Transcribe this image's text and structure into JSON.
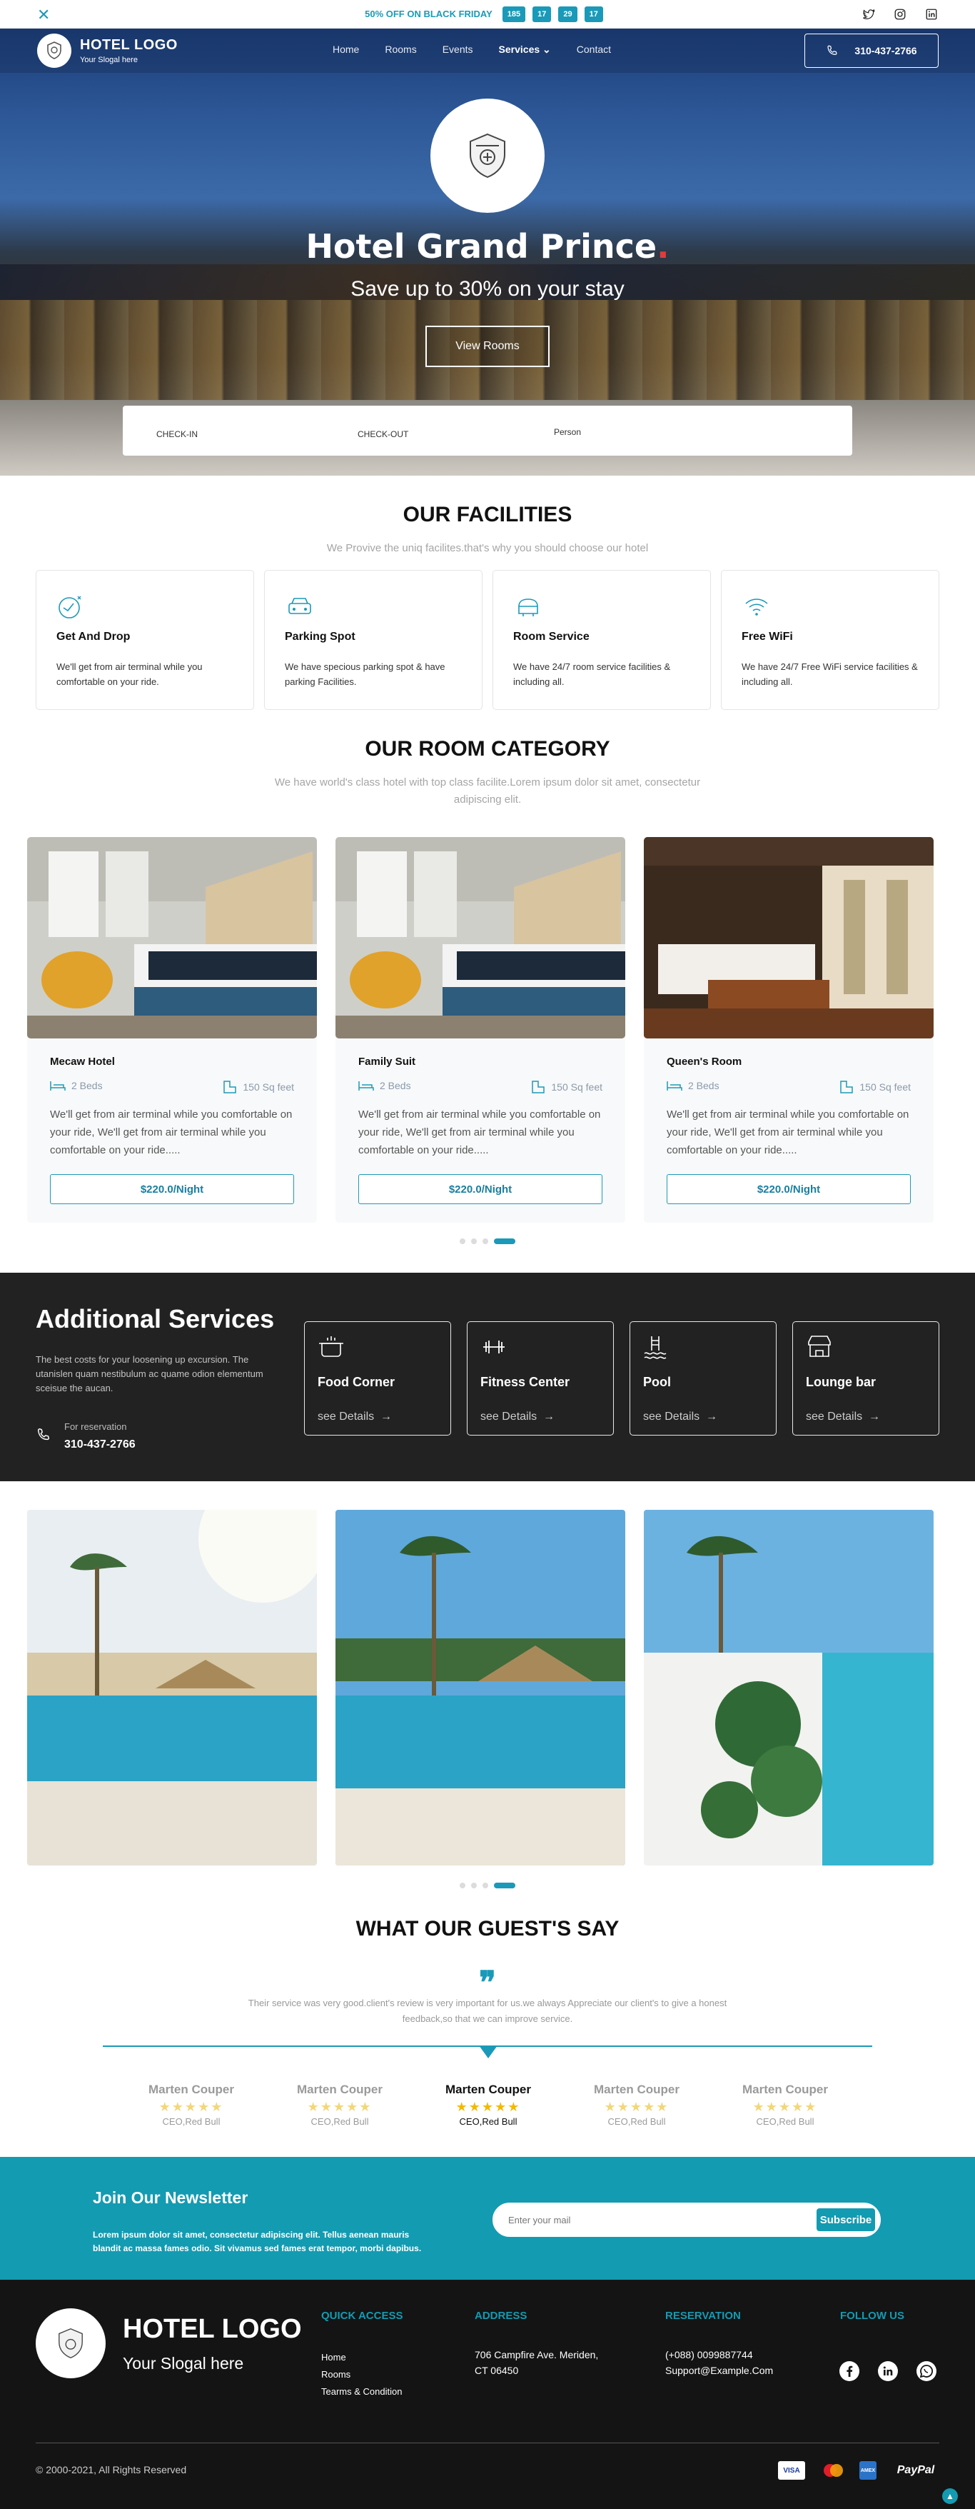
{
  "topbar": {
    "promo": "50% OFF ON BLACK FRIDAY",
    "countdown": [
      "185",
      "17",
      "29",
      "17"
    ],
    "social": [
      "twitter-icon",
      "instagram-icon",
      "linkedin-icon"
    ]
  },
  "nav": {
    "logo_title": "HOTEL LOGO",
    "logo_sub": "Your Slogal here",
    "items": [
      "Home",
      "Rooms",
      "Events",
      "Services",
      "Contact"
    ],
    "phone": "310-437-2766"
  },
  "hero": {
    "title": "Hotel Grand Prince",
    "title_dot": ".",
    "subtitle": "Save up to 30% on your stay",
    "cta": "View Rooms",
    "booking": {
      "checkin": "CHECK-IN",
      "checkout": "CHECK-OUT",
      "person": "Person"
    }
  },
  "facilities": {
    "title": "OUR FACILITIES",
    "subtitle": "We Provive the uniq facilites.that's why you should choose our hotel",
    "items": [
      {
        "title": "Get And Drop",
        "desc": "We'll get from air terminal while you comfortable on your ride.",
        "icon": "pickup-icon"
      },
      {
        "title": "Parking Spot",
        "desc": "We have specious parking spot & have parking Facilities.",
        "icon": "car-icon"
      },
      {
        "title": "Room Service",
        "desc": "We have 24/7 room service facilities & including all.",
        "icon": "room-service-icon"
      },
      {
        "title": "Free WiFi",
        "desc": "We have 24/7 Free WiFi service facilities & including all.",
        "icon": "wifi-icon"
      }
    ]
  },
  "rooms": {
    "title": "OUR ROOM CATEGORY",
    "subtitle": "We have world's class hotel with top class facilite.Lorem ipsum dolor sit amet, consectetur adipiscing elit.",
    "items": [
      {
        "name": "Mecaw Hotel",
        "beds": "2 Beds",
        "size": "150 Sq feet",
        "desc": "We'll get from air terminal while you comfortable on your ride, We'll get from air terminal while you comfortable on your ride.....",
        "price": "$220.0/Night"
      },
      {
        "name": "Family Suit",
        "beds": "2 Beds",
        "size": "150 Sq feet",
        "desc": "We'll get from air terminal while you comfortable on your ride, We'll get from air terminal while you comfortable on your ride.....",
        "price": "$220.0/Night"
      },
      {
        "name": "Queen's Room",
        "beds": "2 Beds",
        "size": "150 Sq feet",
        "desc": "We'll get from air terminal while you comfortable on your ride, We'll get from air terminal while you comfortable on your ride.....",
        "price": "$220.0/Night"
      }
    ]
  },
  "services": {
    "title": "Additional Services",
    "desc": "The best costs for your loosening up excursion. The utanislen quam nestibulum ac quame odion elementum sceisue the aucan.",
    "res_label": "For reservation",
    "res_phone": "310-437-2766",
    "items": [
      {
        "title": "Food Corner",
        "link": "see Details",
        "icon": "cooking-pot-icon"
      },
      {
        "title": "Fitness Center",
        "link": "see Details",
        "icon": "dumbbell-icon"
      },
      {
        "title": "Pool",
        "link": "see Details",
        "icon": "pool-icon"
      },
      {
        "title": "Lounge bar",
        "link": "see Details",
        "icon": "bar-icon"
      }
    ]
  },
  "testimonials": {
    "title": "WHAT OUR GUEST'S SAY",
    "quote": "Their service was very good.client's review is very important for us.we always Appreciate our client's to give a honest feedback,so that we can improve service.",
    "guests": [
      {
        "name": "Marten Couper",
        "role": "CEO,Red Bull",
        "stars": "★★★★★"
      },
      {
        "name": "Marten Couper",
        "role": "CEO,Red Bull",
        "stars": "★★★★★"
      },
      {
        "name": "Marten Couper",
        "role": "CEO,Red Bull",
        "stars": "★★★★★"
      },
      {
        "name": "Marten Couper",
        "role": "CEO,Red Bull",
        "stars": "★★★★★"
      },
      {
        "name": "Marten Couper",
        "role": "CEO,Red Bull",
        "stars": "★★★★★"
      }
    ]
  },
  "newsletter": {
    "title": "Join Our Newsletter",
    "desc": "Lorem ipsum dolor sit amet, consectetur adipiscing elit. Tellus aenean mauris blandit ac massa fames odio. Sit vivamus sed fames erat tempor, morbi dapibus.",
    "placeholder": "Enter your mail",
    "button": "Subscribe"
  },
  "footer": {
    "logo_title": "HOTEL LOGO",
    "logo_sub": "Your Slogal here",
    "quick_access": {
      "title": "QUICK ACCESS",
      "links": [
        "Home",
        "Rooms",
        "Tearms & Condition"
      ]
    },
    "address": {
      "title": "ADDRESS",
      "lines": [
        "706 Campfire Ave. Meriden,",
        "CT 06450"
      ]
    },
    "reservation": {
      "title": "RESERVATION",
      "lines": [
        "(+088) 0099887744",
        "Support@Example.Com"
      ]
    },
    "follow": {
      "title": "FOLLOW US"
    },
    "copyright": "© 2000-2021, All Rights Reserved",
    "payments": [
      "VISA",
      "mastercard",
      "AMEX",
      "PayPal"
    ]
  },
  "colors": {
    "accent": "#1a9ab8",
    "dark": "#222222",
    "footer": "#141414"
  }
}
